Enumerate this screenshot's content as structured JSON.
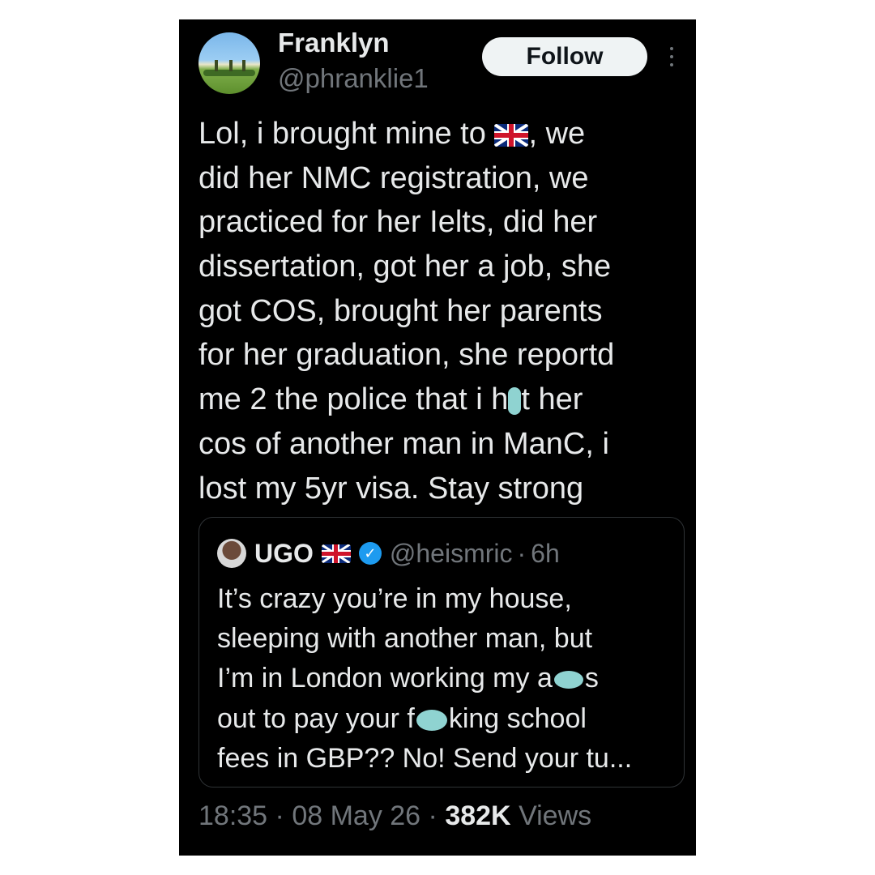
{
  "author": {
    "name": "Franklyn",
    "handle": "@phranklie1"
  },
  "follow_label": "Follow",
  "icons": {
    "more": "more-vertical-icon",
    "flag": "uk-flag-icon",
    "verified": "verified-badge-icon"
  },
  "tweet": {
    "lines": [
      "Lol, i brought mine to",
      ", we",
      "did her NMC registration, we",
      "practiced for her Ielts, did her",
      "dissertation, got her a job, she",
      "got COS, brought her parents",
      "for her graduation, she reportd",
      "me 2 the police that i h",
      "t her",
      "cos of another man in ManC, i",
      "lost my 5yr visa. Stay strong"
    ]
  },
  "quoted": {
    "name": "UGO",
    "handle": "@heismric",
    "separator": "·",
    "time": "6h",
    "lines": [
      "It’s crazy you’re in my house,",
      "sleeping with another man, but",
      "I’m in London working my a",
      "s",
      "out to pay your f",
      "king school",
      "fees in GBP?? No! Send your tu..."
    ]
  },
  "meta": {
    "time": "18:35",
    "sep1": "·",
    "date": "08 May 26",
    "sep2": "·",
    "views_count": "382K",
    "views_label": "Views"
  },
  "colors": {
    "background": "#000000",
    "text_primary": "#e7e9ea",
    "text_secondary": "#71767b",
    "follow_bg": "#eff3f4",
    "verified": "#1d9bf0",
    "censor_blob": "#8fd3d1"
  }
}
